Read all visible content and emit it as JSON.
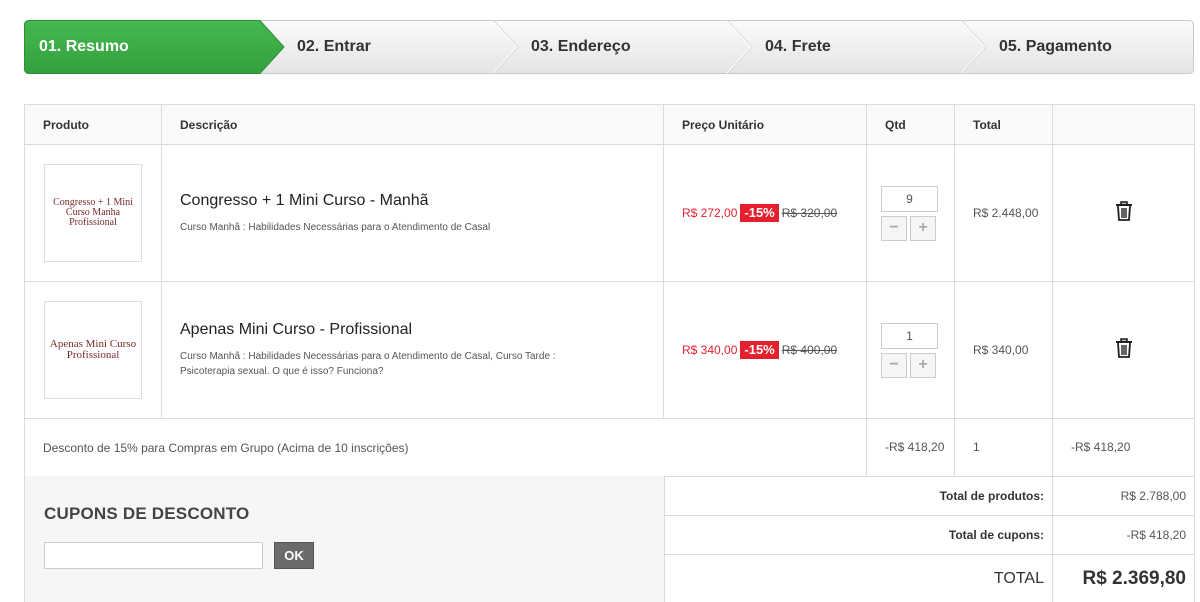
{
  "steps": [
    {
      "label": "01. Resumo",
      "active": true
    },
    {
      "label": "02. Entrar",
      "active": false
    },
    {
      "label": "03. Endereço",
      "active": false
    },
    {
      "label": "04. Frete",
      "active": false
    },
    {
      "label": "05. Pagamento",
      "active": false
    }
  ],
  "colors": {
    "active_step": "#3fae49",
    "price_red": "#e4202f"
  },
  "table": {
    "headers": {
      "product": "Produto",
      "description": "Descrição",
      "unit_price": "Preço Unitário",
      "qty": "Qtd",
      "total": "Total"
    },
    "items": [
      {
        "thumb_text": "Congresso + 1 Mini Curso Manha Profissional",
        "name": "Congresso + 1 Mini Curso - Manhã",
        "attributes": "Curso Manhã : Habilidades Necessárias para o Atendimento de Casal",
        "price_new": "R$ 272,00",
        "discount": "-15%",
        "price_old": "R$ 320,00",
        "qty": "9",
        "minus": "−",
        "plus": "+",
        "total": "R$ 2.448,00"
      },
      {
        "thumb_text": "Apenas Mini Curso Profissional",
        "name": "Apenas Mini Curso - Profissional",
        "attributes": "Curso Manhã : Habilidades Necessárias para o Atendimento de Casal, Curso Tarde : Psicoterapia sexual. O que é isso? Funciona?",
        "price_new": "R$ 340,00",
        "discount": "-15%",
        "price_old": "R$ 400,00",
        "qty": "1",
        "minus": "−",
        "plus": "+",
        "total": "R$ 340,00"
      }
    ],
    "group_discount": {
      "text": "Desconto de 15% para Compras em Grupo (Acima de 10 inscrições)",
      "unit_value": "-R$ 418,20",
      "qty": "1",
      "total": "-R$ 418,20"
    }
  },
  "coupons": {
    "title": "CUPONS DE DESCONTO",
    "input_value": "",
    "button": "OK"
  },
  "totals": {
    "products_label": "Total de produtos:",
    "products_value": "R$ 2.788,00",
    "coupons_label": "Total de cupons:",
    "coupons_value": "-R$ 418,20",
    "grand_label": "TOTAL",
    "grand_value": "R$ 2.369,80"
  }
}
